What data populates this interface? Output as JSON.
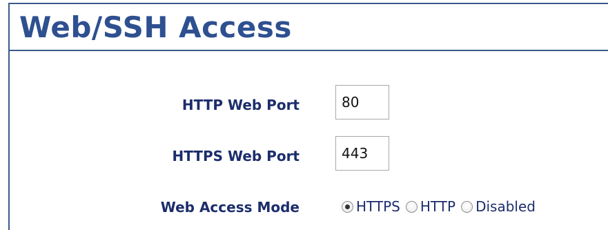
{
  "page_title": "Web/SSH Access",
  "fields": {
    "http_port": {
      "label": "HTTP Web Port",
      "value": "80"
    },
    "https_port": {
      "label": "HTTPS Web Port",
      "value": "443"
    },
    "access_mode": {
      "label": "Web Access Mode",
      "selected": "HTTPS",
      "options": [
        "HTTPS",
        "HTTP",
        "Disabled"
      ]
    }
  },
  "colors": {
    "title": "#2e5090",
    "label": "#1c2d6b",
    "border": "#3b5a8a"
  }
}
